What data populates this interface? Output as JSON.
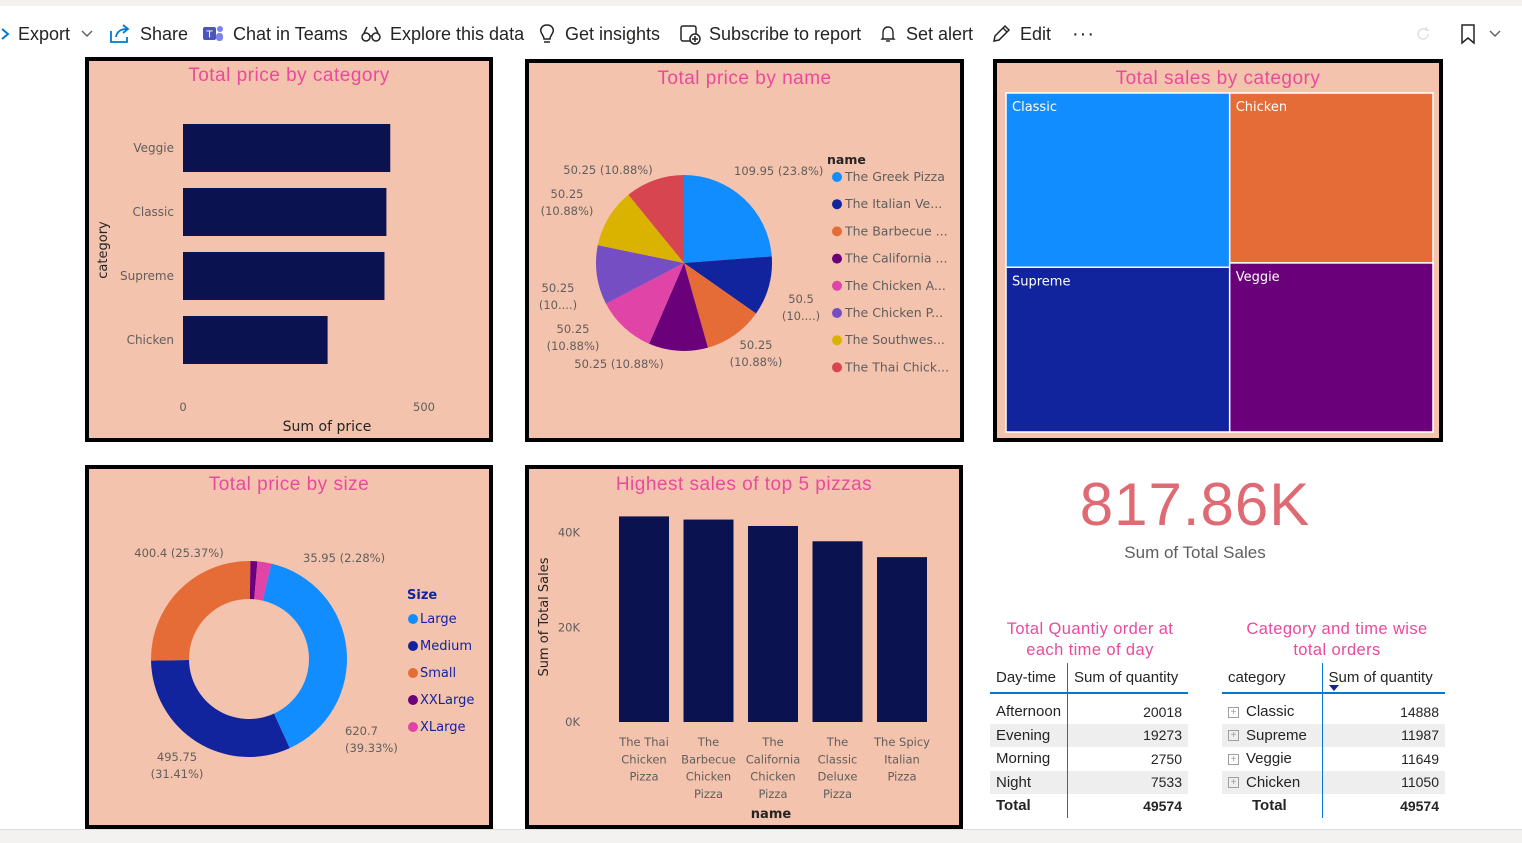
{
  "toolbar": {
    "export": "Export",
    "share": "Share",
    "chat_in_teams": "Chat in Teams",
    "explore": "Explore this data",
    "insights": "Get insights",
    "subscribe": "Subscribe to report",
    "set_alert": "Set alert",
    "edit": "Edit",
    "more": "···"
  },
  "charts": {
    "price_by_category": {
      "title": "Total price by category",
      "ylabel": "category",
      "xlabel": "Sum of price",
      "ticks": [
        "0",
        "500"
      ]
    },
    "price_by_name": {
      "title": "Total price by name",
      "legend_title": "name",
      "legend": [
        "The Greek Pizza",
        "The Italian Ve...",
        "The Barbecue ...",
        "The California ...",
        "The Chicken A...",
        "The Chicken P...",
        "The Southwes...",
        "The Thai Chick..."
      ]
    },
    "sales_by_category": {
      "title": "Total sales by category"
    },
    "price_by_size": {
      "title": "Total price by size",
      "legend_title": "Size"
    },
    "top5": {
      "title": "Highest sales of top 5 pizzas",
      "ylabel": "Sum of Total Sales",
      "xlabel": "name",
      "yticks": [
        "0K",
        "20K",
        "40K"
      ]
    }
  },
  "kpi": {
    "value": "817.86K",
    "label": "Sum of Total Sales"
  },
  "table_time": {
    "title_line1": "Total Quantiy order at",
    "title_line2": "each time of day",
    "col1": "Day-time",
    "col2": "Sum of quantity",
    "rows": [
      {
        "label": "Afternoon",
        "value": "20018"
      },
      {
        "label": "Evening",
        "value": "19273"
      },
      {
        "label": "Morning",
        "value": "2750"
      },
      {
        "label": "Night",
        "value": "7533"
      }
    ],
    "total_label": "Total",
    "total_value": "49574"
  },
  "table_category": {
    "title_line1": "Category and time wise",
    "title_line2": "total orders",
    "col1": "category",
    "col2": "Sum of quantity",
    "rows": [
      {
        "label": "Classic",
        "value": "14888"
      },
      {
        "label": "Supreme",
        "value": "11987"
      },
      {
        "label": "Veggie",
        "value": "11649"
      },
      {
        "label": "Chicken",
        "value": "11050"
      }
    ],
    "total_label": "Total",
    "total_value": "49574"
  },
  "colors": {
    "panel_bg": "#f4c3ae",
    "navy": "#0b1250",
    "title_pink": "#e94a9d",
    "kpi_red": "#de6a73"
  },
  "chart_data": [
    {
      "type": "bar",
      "orientation": "horizontal",
      "title": "Total price by category",
      "categories": [
        "Veggie",
        "Classic",
        "Supreme",
        "Chicken"
      ],
      "values": [
        430,
        422,
        418,
        300
      ],
      "xlim": [
        0,
        500
      ],
      "xlabel": "Sum of price",
      "ylabel": "category"
    },
    {
      "type": "pie",
      "title": "Total price by name",
      "labels": [
        "The Greek Pizza",
        "The Italian Ve...",
        "The Barbecue ...",
        "The California ...",
        "The Chicken A...",
        "The Chicken P...",
        "The Southwes...",
        "The Thai Chick..."
      ],
      "values": [
        109.95,
        50.5,
        50.25,
        50.25,
        50.25,
        50.25,
        50.25,
        50.25
      ],
      "value_labels": [
        "109.95 (23.8%)",
        "50.5 (10....)",
        "50.25 (10.88%)",
        "50.25 (10.88%)",
        "50.25 (10.88%)",
        "50.25 (10....)",
        "50.25 (10.88%)",
        "50.25 (10.88%)"
      ],
      "colors": [
        "#118dff",
        "#12239e",
        "#e66c37",
        "#6b007b",
        "#e044a7",
        "#744ec2",
        "#d9b300",
        "#d64550"
      ]
    },
    {
      "type": "treemap",
      "title": "Total sales by category",
      "labels": [
        "Classic",
        "Chicken",
        "Supreme",
        "Veggie"
      ],
      "values": [
        220,
        195,
        208,
        194
      ],
      "colors": [
        "#118dff",
        "#e66c37",
        "#12239e",
        "#6b007b"
      ]
    },
    {
      "type": "donut",
      "title": "Total price by size",
      "labels": [
        "Large",
        "Medium",
        "Small",
        "XXLarge",
        "XLarge"
      ],
      "values": [
        620.7,
        495.75,
        400.4,
        0.0,
        35.95
      ],
      "value_labels": [
        "620.7 (39.33%)",
        "495.75 (31.41%)",
        "400.4 (25.37%)",
        "",
        "35.95 (2.28%)"
      ],
      "colors": [
        "#118dff",
        "#12239e",
        "#e66c37",
        "#6b007b",
        "#e044a7"
      ]
    },
    {
      "type": "bar",
      "title": "Highest sales of top 5 pizzas",
      "categories": [
        "The Thai Chicken Pizza",
        "The Barbecue Chicken Pizza",
        "The California Chicken Pizza",
        "The Classic Deluxe Pizza",
        "The Spicy Italian Pizza"
      ],
      "values": [
        43434,
        42768,
        41410,
        38180,
        34831
      ],
      "ylim": [
        0,
        45000
      ],
      "xlabel": "name",
      "ylabel": "Sum of Total Sales"
    }
  ]
}
